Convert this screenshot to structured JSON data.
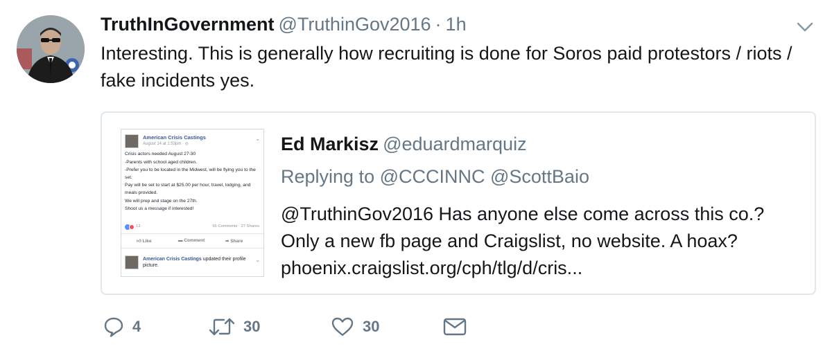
{
  "tweet": {
    "display_name": "TruthInGovernment",
    "handle": "@TruthinGov2016",
    "separator": "·",
    "time": "1h",
    "text": "Interesting. This is generally how recruiting is done for Soros paid protestors / riots / fake incidents yes."
  },
  "quoted_tweet": {
    "display_name": "Ed Markisz",
    "handle": "@eduardmarquiz",
    "replying_to": "Replying to @CCCINNC @ScottBaio",
    "text_lines": [
      "@TruthinGov2016 Has anyone else come across this co.?",
      "Only a new fb page and Craigslist, no website. A hoax?",
      "phoenix.craigslist.org/cph/tlg/d/cris..."
    ],
    "media": {
      "page_name": "American Crisis Castings",
      "date": "August 14 at 1:53pm · ◎",
      "body_lines": [
        "Crisis actors needed August 27-30",
        "-Parents with school aged children.",
        "-Prefer you to be located in the Midwest, will be flying you to the set.",
        "Pay will be set to start at $25.00 per hour, travel, lodging, and meals provided.",
        "We will prep and stage on the 27th.",
        "Shoot us a message if interested!"
      ],
      "reaction_count": "13",
      "comments_shares": "55 Comments · 27 Shares",
      "like_label": "Like",
      "comment_label": "Comment",
      "share_label": "Share",
      "second_post_name": "American Crisis Castings",
      "second_post_rest": " updated their profile picture."
    }
  },
  "actions": {
    "reply_count": "4",
    "retweet_count": "30",
    "like_count": "30"
  },
  "icons": {
    "caret": "chevron-down-icon",
    "reply": "reply-icon",
    "retweet": "retweet-icon",
    "like": "heart-icon",
    "dm": "envelope-icon"
  },
  "colors": {
    "text": "#14171a",
    "secondary": "#657786",
    "border": "#e1e8ed",
    "fb_link": "#365899"
  }
}
